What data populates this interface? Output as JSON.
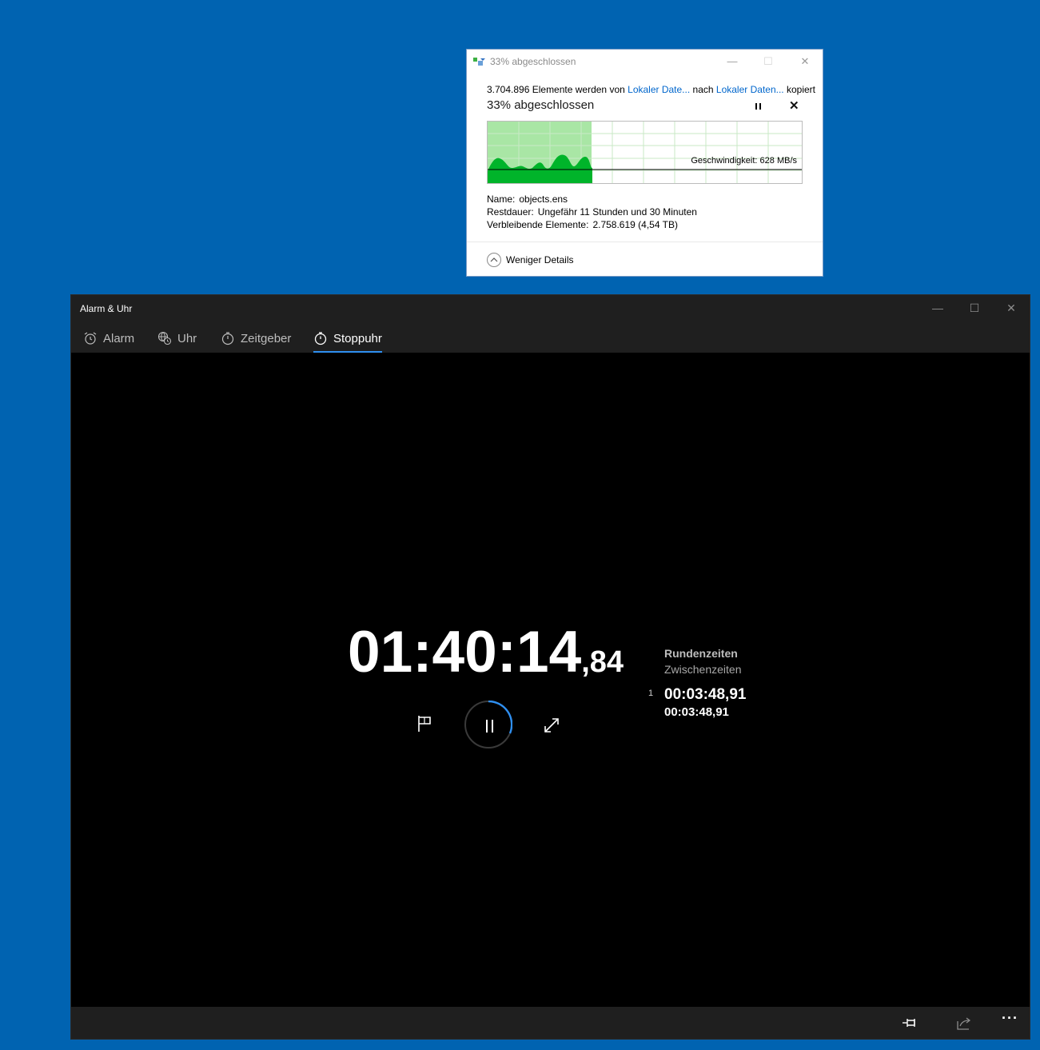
{
  "copy_dialog": {
    "title": "33% abgeschlossen",
    "window_buttons": {
      "minimize": "—",
      "maximize": "☐",
      "close": "✕"
    },
    "summary": {
      "count_text": "3.704.896 Elemente werden von",
      "source": "Lokaler Date...",
      "middle": "nach",
      "destination": "Lokaler Daten...",
      "suffix": "kopiert"
    },
    "headline": "33% abgeschlossen",
    "progress_percent": 33,
    "speed_label": "Geschwindigkeit: 628 MB/s",
    "details": {
      "name_label": "Name:",
      "name_value": "objects.ens",
      "remaining_time_label": "Restdauer:",
      "remaining_time_value": "Ungefähr 11 Stunden und 30 Minuten",
      "remaining_items_label": "Verbleibende Elemente:",
      "remaining_items_value": "2.758.619 (4,54 TB)"
    },
    "less_details_label": "Weniger Details",
    "icons": {
      "pause": "pause-icon",
      "cancel": "close-icon",
      "toggle": "chevron-up-icon"
    },
    "colors": {
      "graph_fill": "#00b42a",
      "graph_bg": "#a9e6a5",
      "link": "#0066cc"
    }
  },
  "clock_window": {
    "title": "Alarm & Uhr",
    "window_buttons": {
      "minimize": "—",
      "maximize": "☐",
      "close": "✕"
    },
    "tabs": [
      {
        "label": "Alarm",
        "icon": "alarm-clock-icon",
        "active": false
      },
      {
        "label": "Uhr",
        "icon": "world-clock-icon",
        "active": false
      },
      {
        "label": "Zeitgeber",
        "icon": "timer-icon",
        "active": false
      },
      {
        "label": "Stoppuhr",
        "icon": "stopwatch-icon",
        "active": true
      }
    ],
    "stopwatch": {
      "time_main": "01:40:14",
      "time_fraction": ",84"
    },
    "laps": {
      "header_lap": "Rundenzeiten",
      "header_split": "Zwischenzeiten",
      "entries": [
        {
          "number": "1",
          "lap_time": "00:03:48,91",
          "split_time": "00:03:48,91"
        }
      ]
    },
    "bottom_icons": [
      "pin-icon",
      "share-icon",
      "more-icon"
    ],
    "more_label": "···",
    "colors": {
      "accent": "#2f8ff0",
      "background": "#000000",
      "chrome": "#1f1f1f"
    }
  }
}
